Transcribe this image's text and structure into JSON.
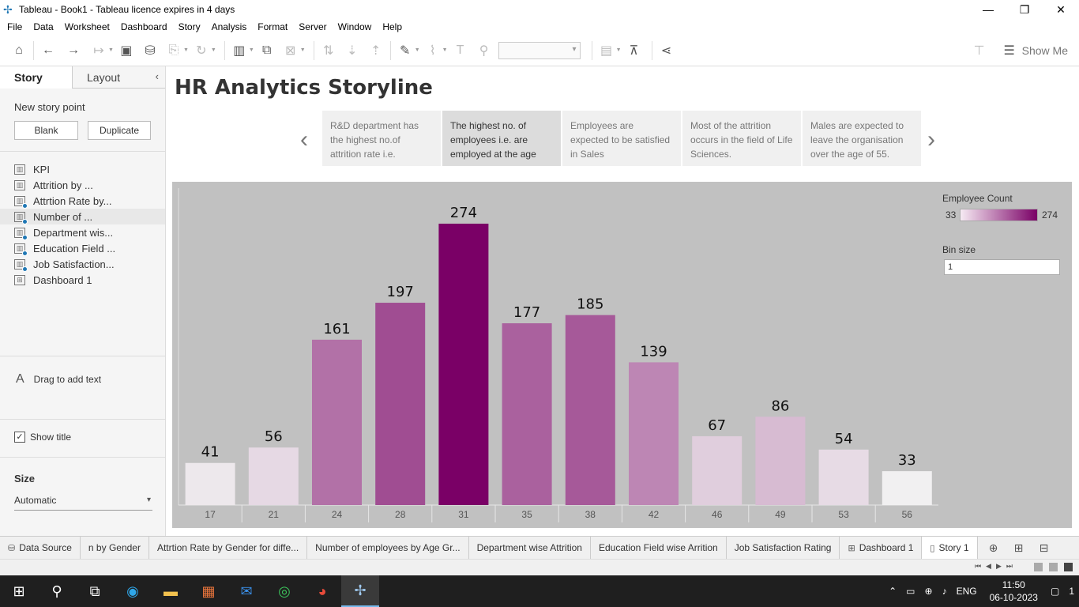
{
  "window": {
    "title": "Tableau - Book1 - Tableau licence expires in 4 days",
    "controls": [
      "—",
      "❐",
      "✕"
    ]
  },
  "menu": [
    "File",
    "Data",
    "Worksheet",
    "Dashboard",
    "Story",
    "Analysis",
    "Format",
    "Server",
    "Window",
    "Help"
  ],
  "toolbar": {
    "show_me": "Show Me"
  },
  "left_pane": {
    "tab_story": "Story",
    "tab_layout": "Layout",
    "new_story_point": "New story point",
    "blank_button": "Blank",
    "duplicate_button": "Duplicate",
    "sheets": [
      {
        "label": "KPI",
        "type": "worksheet",
        "used": false
      },
      {
        "label": "Attrition by ...",
        "type": "worksheet",
        "used": false
      },
      {
        "label": "Attrtion Rate by...",
        "type": "worksheet",
        "used": true
      },
      {
        "label": "Number of ...",
        "type": "worksheet",
        "used": true
      },
      {
        "label": "Department wis...",
        "type": "worksheet",
        "used": true
      },
      {
        "label": "Education Field ...",
        "type": "worksheet",
        "used": true
      },
      {
        "label": "Job Satisfaction...",
        "type": "worksheet",
        "used": true
      },
      {
        "label": "Dashboard 1",
        "type": "dashboard",
        "used": false
      }
    ],
    "drag_text": "Drag to add text",
    "show_title": "Show title",
    "size_label": "Size",
    "size_value": "Automatic"
  },
  "story": {
    "title": "HR Analytics Storyline",
    "points": [
      "R&D department has the highest no.of attrition rate i.e.",
      "The highest no. of employees i.e. are employed at the age",
      "Employees are expected to be satisfied in Sales",
      "Most of the attrition occurs in the field of Life Sciences.",
      "Males are expected to leave the organisation over the age of 55."
    ],
    "active_point": 1
  },
  "legend": {
    "title": "Employee Count",
    "min": "33",
    "max": "274",
    "color_low": "#f6eaf3",
    "color_high": "#7a0066"
  },
  "bin": {
    "label": "Bin size",
    "value": "1"
  },
  "chart_data": {
    "type": "bar",
    "categories": [
      "17",
      "21",
      "24",
      "28",
      "31",
      "35",
      "38",
      "42",
      "46",
      "49",
      "53",
      "56"
    ],
    "values": [
      41,
      56,
      161,
      197,
      274,
      177,
      185,
      139,
      67,
      86,
      54,
      33
    ],
    "title": "",
    "xlabel": "",
    "ylabel": "",
    "ylim": [
      0,
      274
    ],
    "grid": false
  },
  "bottom_tabs": [
    {
      "label": "Data Source",
      "icon": "database-icon",
      "active": false
    },
    {
      "label": "n by Gender",
      "icon": "",
      "active": false
    },
    {
      "label": "Attrtion Rate by Gender for diffe...",
      "icon": "",
      "active": false
    },
    {
      "label": "Number of employees by Age Gr...",
      "icon": "",
      "active": false
    },
    {
      "label": "Department wise Attrition",
      "icon": "",
      "active": false
    },
    {
      "label": "Education Field wise Arrition",
      "icon": "",
      "active": false
    },
    {
      "label": "Job Satisfaction Rating",
      "icon": "",
      "active": false
    },
    {
      "label": "Dashboard 1",
      "icon": "dashboard-icon",
      "active": false
    },
    {
      "label": "Story 1",
      "icon": "story-icon",
      "active": true
    }
  ],
  "taskbar": {
    "language": "ENG",
    "time": "11:50",
    "date": "06-10-2023",
    "notifications": "1"
  }
}
